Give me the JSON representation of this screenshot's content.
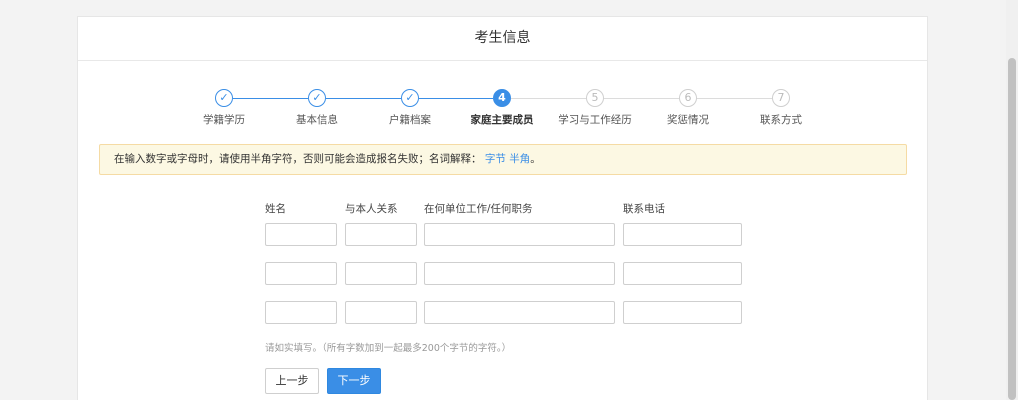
{
  "header": {
    "title": "考生信息"
  },
  "steps": [
    {
      "num": "✓",
      "label": "学籍学历",
      "state": "done"
    },
    {
      "num": "✓",
      "label": "基本信息",
      "state": "done"
    },
    {
      "num": "✓",
      "label": "户籍档案",
      "state": "done"
    },
    {
      "num": "4",
      "label": "家庭主要成员",
      "state": "active"
    },
    {
      "num": "5",
      "label": "学习与工作经历",
      "state": "todo"
    },
    {
      "num": "6",
      "label": "奖惩情况",
      "state": "todo"
    },
    {
      "num": "7",
      "label": "联系方式",
      "state": "todo"
    }
  ],
  "notice": {
    "text": "在输入数字或字母时，请使用半角字符，否则可能会造成报名失败；名词解释：",
    "link_bytes": "字节",
    "link_halfwidth": "半角",
    "end": "。"
  },
  "form": {
    "columns": {
      "name": "姓名",
      "relation": "与本人关系",
      "work": "在何单位工作/任何职务",
      "phone": "联系电话"
    },
    "rows": [
      {
        "name": "",
        "relation": "",
        "work": "",
        "phone": ""
      },
      {
        "name": "",
        "relation": "",
        "work": "",
        "phone": ""
      },
      {
        "name": "",
        "relation": "",
        "work": "",
        "phone": ""
      }
    ],
    "hint": "请如实填写。（所有字数加到一起最多200个字节的字符。）"
  },
  "buttons": {
    "prev": "上一步",
    "next": "下一步"
  },
  "colors": {
    "accent": "#3a8ee6",
    "notice_bg": "#fcf8e3",
    "notice_border": "#f5dba4"
  }
}
